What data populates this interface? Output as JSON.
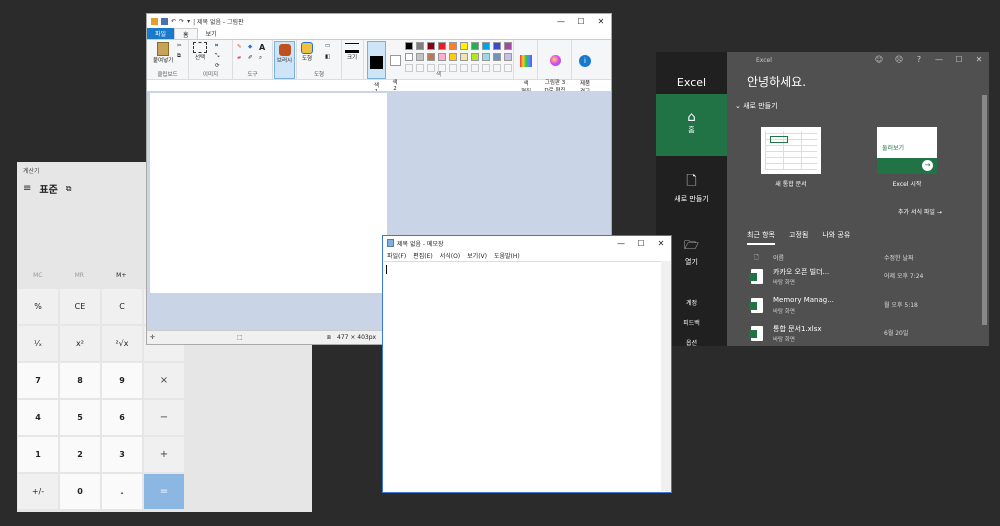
{
  "calculator": {
    "title": "계산기",
    "mode": "표준",
    "memory": [
      "MC",
      "MR",
      "M+",
      "M-"
    ],
    "keys": [
      "%",
      "CE",
      "C",
      "",
      "¹⁄ₓ",
      "x²",
      "²√x",
      "",
      "7",
      "8",
      "9",
      "×",
      "4",
      "5",
      "6",
      "−",
      "1",
      "2",
      "3",
      "+",
      "+/-",
      "0",
      ".",
      "="
    ]
  },
  "paint": {
    "title": "| 제목 없음 - 그림판",
    "tabs": {
      "file": "파일",
      "home": "홈",
      "view": "보기"
    },
    "ribbon": {
      "paste": "붙여넣기",
      "select": "선택",
      "brushes": "브러시",
      "shapes": "도형",
      "size": "크기",
      "color1": "색\n1",
      "color2": "색\n2",
      "edit_colors": "색\n편집",
      "paint3d": "그림판 3\nD로 편집",
      "product_alert": "제품\n경고"
    },
    "groups": {
      "clipboard": "클립보드",
      "image": "이미지",
      "tools": "도구",
      "shapes": "도형",
      "colors": "색"
    },
    "palette": [
      "#000000",
      "#7f7f7f",
      "#880015",
      "#ed1c24",
      "#ff7f27",
      "#fff200",
      "#22b14c",
      "#00a2e8",
      "#3f48cc",
      "#a349a4",
      "#ffffff",
      "#c3c3c3",
      "#b97a57",
      "#ffaec9",
      "#ffc90e",
      "#efe4b0",
      "#b5e61d",
      "#99d9ea",
      "#7092be",
      "#c8bfe7"
    ],
    "status": {
      "canvas_size": "477 × 403px"
    }
  },
  "excel": {
    "window_title": "Excel",
    "brand": "Excel",
    "nav": {
      "home": "홈",
      "new": "새로 만들기",
      "open": "열기",
      "account": "계정",
      "feedback": "피드백",
      "options": "옵션"
    },
    "greeting": "안녕하세요.",
    "new_section": "새로 만들기",
    "templates": [
      {
        "label": "새 통합 문서"
      },
      {
        "label": "Excel 시작",
        "preview_text": "둘러보기"
      }
    ],
    "more_templates": "추가 서식 파일",
    "tabs": [
      "최근 항목",
      "고정됨",
      "나와 공유"
    ],
    "col_name": "이름",
    "col_date": "수정한 날짜",
    "recent": [
      {
        "name": "카카오 오픈 빌더...",
        "location": "바탕 화면",
        "date": "어제 오후 7:24"
      },
      {
        "name": "Memory Manag...",
        "location": "바탕 화면",
        "date": "월 오후 5:18"
      },
      {
        "name": "통합 문서1.xlsx",
        "location": "바탕 화면",
        "date": "6월 20일"
      }
    ]
  },
  "notepad": {
    "title": "제목 없음 - 메모장",
    "menu": [
      "파일(F)",
      "편집(E)",
      "서식(O)",
      "보기(V)",
      "도움말(H)"
    ]
  }
}
